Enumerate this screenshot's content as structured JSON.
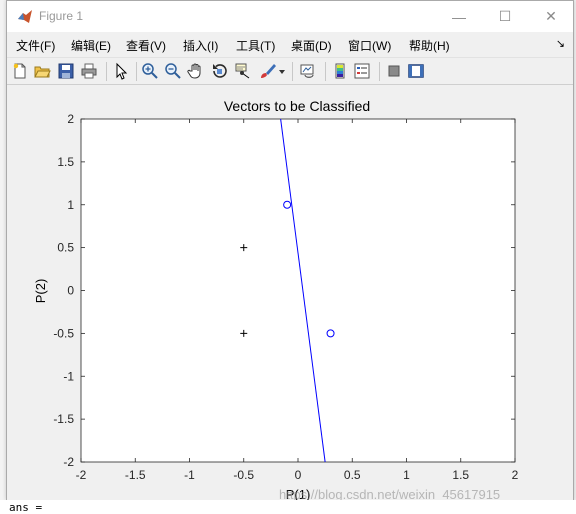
{
  "window": {
    "title": "Figure 1",
    "minimize_glyph": "—",
    "maximize_glyph": "☐",
    "close_glyph": "✕"
  },
  "menubar": {
    "items": [
      {
        "label": "文件(F)"
      },
      {
        "label": "编辑(E)"
      },
      {
        "label": "查看(V)"
      },
      {
        "label": "插入(I)"
      },
      {
        "label": "工具(T)"
      },
      {
        "label": "桌面(D)"
      },
      {
        "label": "窗口(W)"
      },
      {
        "label": "帮助(H)"
      }
    ],
    "overflow_glyph": "↘"
  },
  "toolbar": {
    "icons": [
      "new-figure-icon",
      "open-file-icon",
      "save-icon",
      "print-icon",
      "edit-plot-pointer-icon",
      "zoom-in-icon",
      "zoom-out-icon",
      "pan-hand-icon",
      "rotate-3d-icon",
      "data-cursor-icon",
      "brush-icon",
      "brush-dropdown-icon",
      "link-plot-icon",
      "insert-colorbar-icon",
      "insert-legend-icon",
      "hide-plot-tools-icon",
      "show-plot-tools-icon"
    ]
  },
  "chart_data": {
    "type": "scatter",
    "title": "Vectors to be Classified",
    "xlabel": "P(1)",
    "ylabel": "P(2)",
    "xlim": [
      -2,
      2
    ],
    "ylim": [
      -2,
      2
    ],
    "xticks": [
      "-2",
      "-1.5",
      "-1",
      "-0.5",
      "0",
      "0.5",
      "1",
      "1.5",
      "2"
    ],
    "yticks": [
      "-2",
      "-1.5",
      "-1",
      "-0.5",
      "0",
      "0.5",
      "1",
      "1.5",
      "2"
    ],
    "grid": false,
    "series": [
      {
        "marker": "plus",
        "color": "#000000",
        "points": [
          [
            -0.5,
            0.5
          ],
          [
            -0.5,
            -0.5
          ]
        ]
      },
      {
        "marker": "circle",
        "color": "#0000ff",
        "points": [
          [
            -0.1,
            1.0
          ],
          [
            0.3,
            -0.5
          ]
        ]
      }
    ],
    "line": {
      "color": "#0000ff",
      "points": [
        [
          -0.16,
          2.0
        ],
        [
          0.25,
          -2.0
        ]
      ]
    }
  },
  "desktop": {
    "command_text": "ans ="
  },
  "watermark": "https://blog.csdn.net/weixin_45617915"
}
